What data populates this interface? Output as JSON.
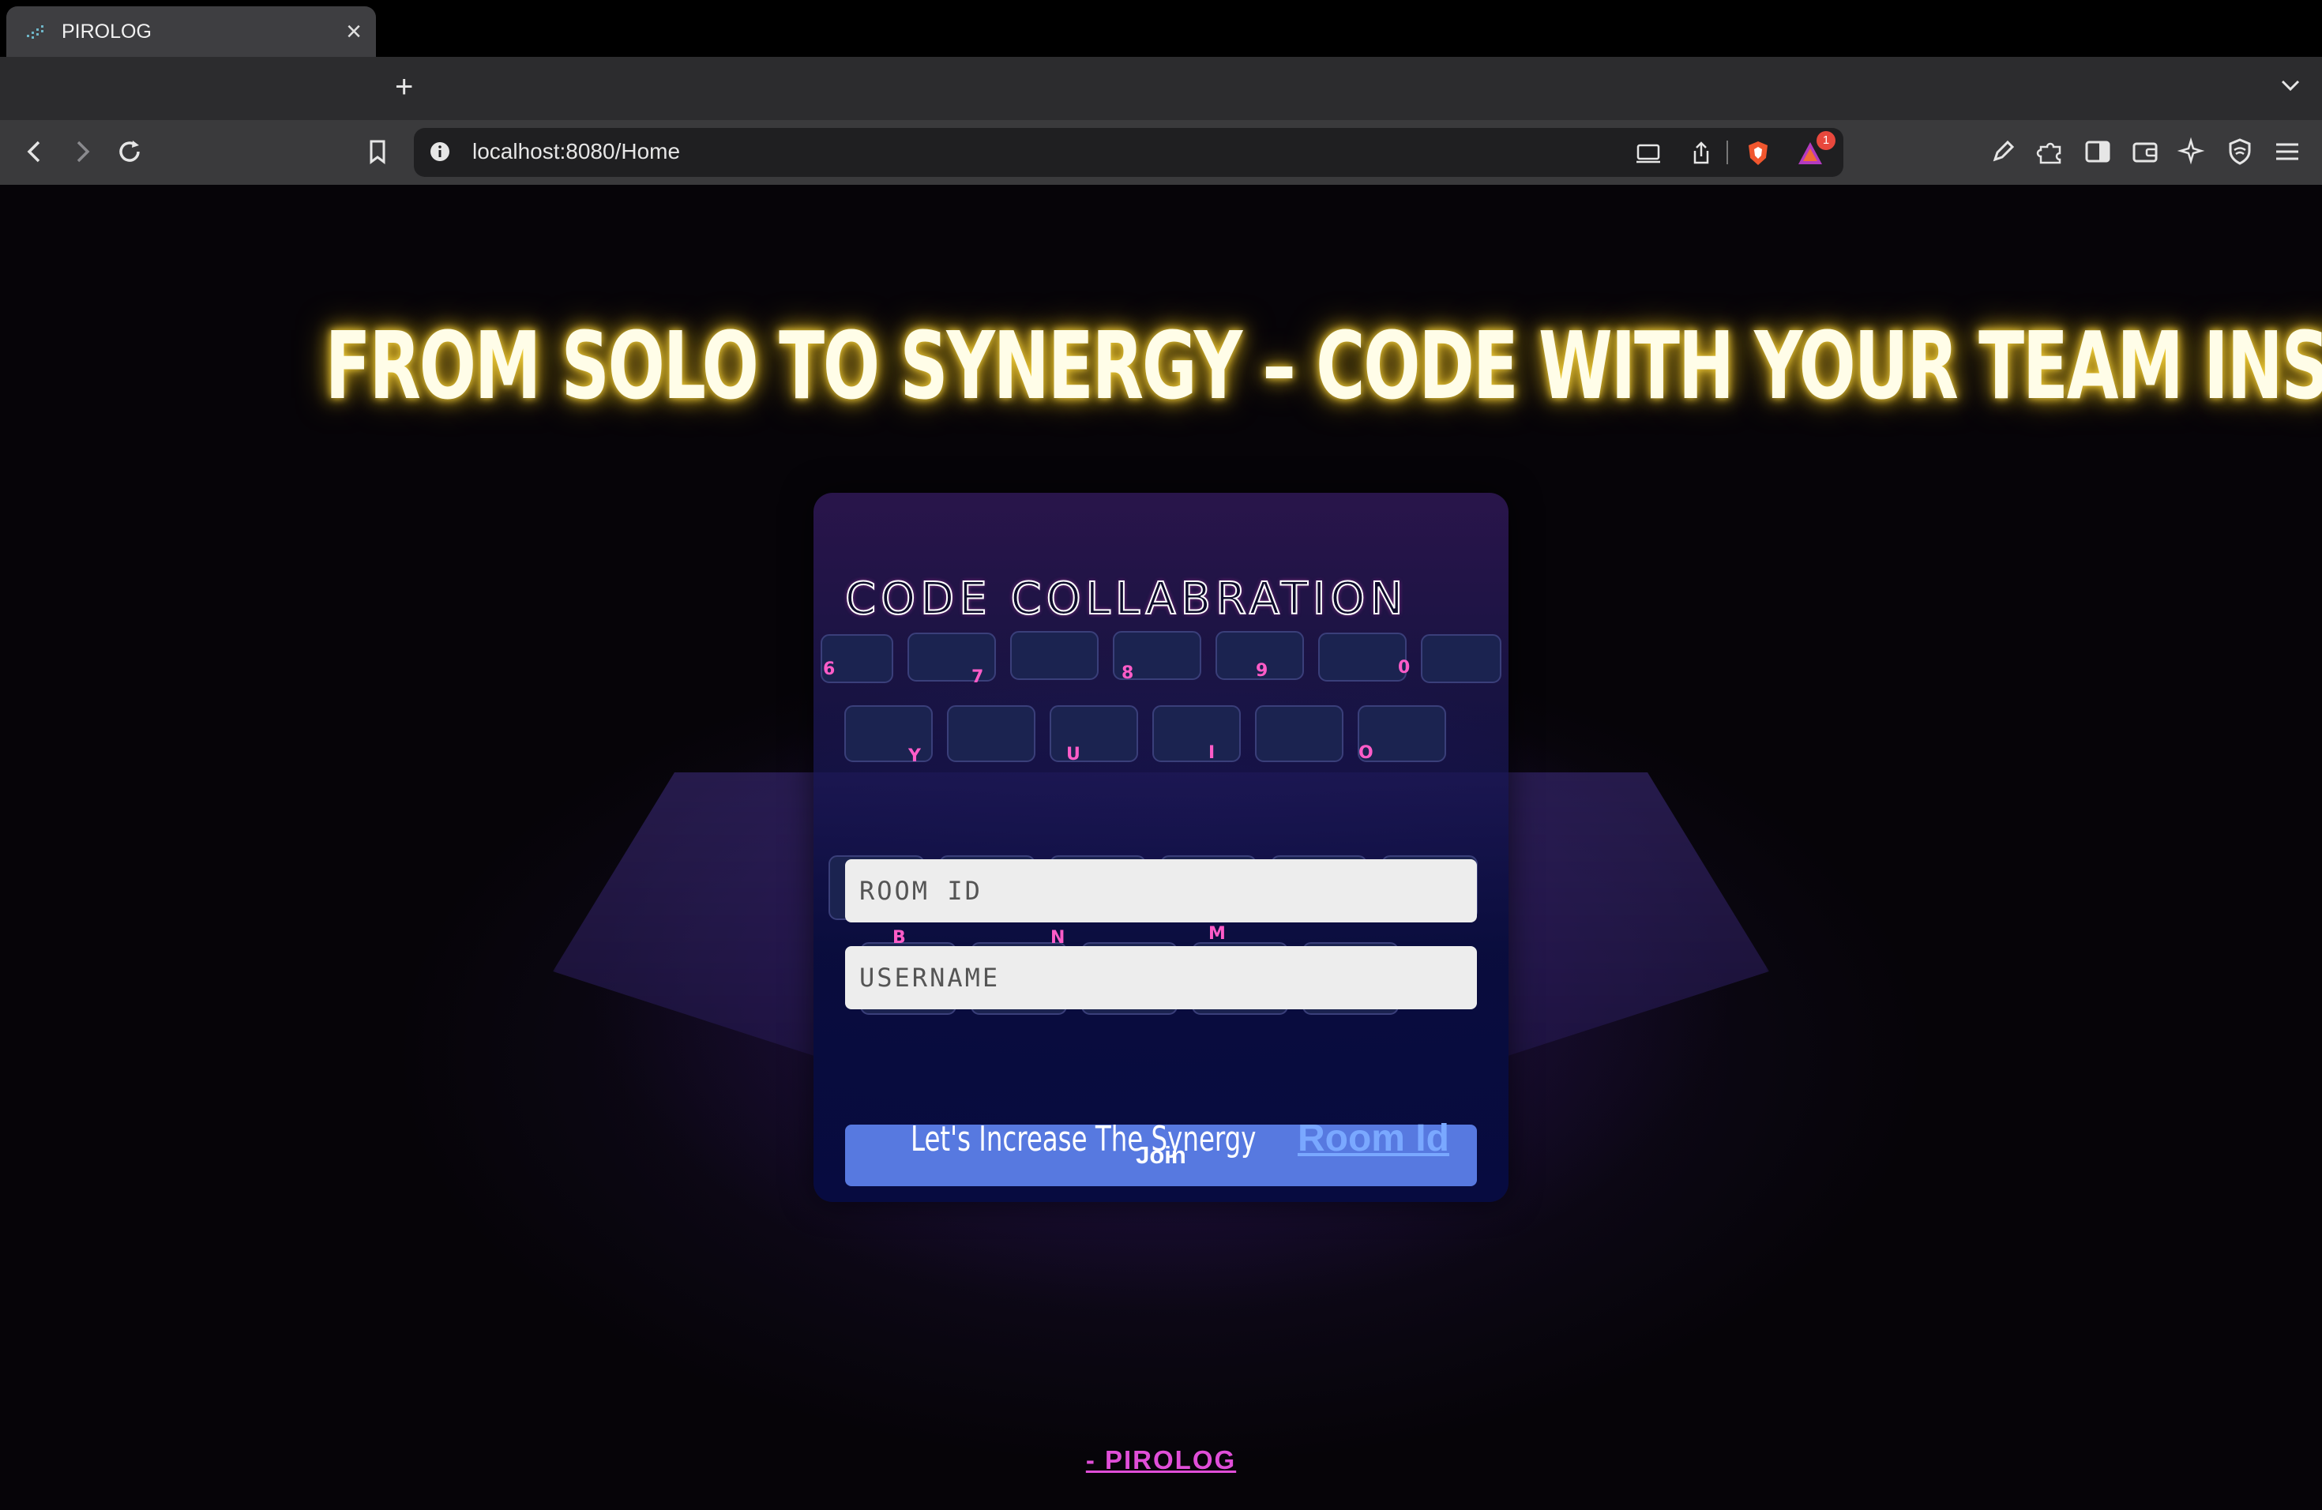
{
  "browser": {
    "tab_title": "PIROLOG",
    "tab_close_glyph": "×",
    "new_tab_glyph": "+",
    "url": "localhost:8080/Home",
    "notification_count": "1"
  },
  "page": {
    "headline": "FROM SOLO TO SYNERGY – CODE WITH YOUR TEAM INSTANTLY!",
    "card_title": "CODE COLLABRATION",
    "room_placeholder": "ROOM ID",
    "username_placeholder": "USERNAME",
    "join_label": "Join",
    "tagline_text": "Let's Increase The Synergy",
    "tagline_link": "Room Id",
    "footer_link": "- PIROLOG"
  },
  "colors": {
    "headline_glow": "#f5d23d",
    "join_button": "#5779e0",
    "tagline_link": "#7aa8ff",
    "footer_link": "#e04ed8"
  },
  "icons": [
    "back-icon",
    "forward-icon",
    "reload-icon",
    "bookmark-icon",
    "site-info-icon",
    "install-app-icon",
    "share-icon",
    "brave-shields-icon",
    "brave-rewards-icon",
    "edit-icon",
    "extensions-icon",
    "sidebar-icon",
    "wallet-icon",
    "leo-ai-icon",
    "vpn-icon",
    "menu-icon",
    "tab-list-icon"
  ]
}
